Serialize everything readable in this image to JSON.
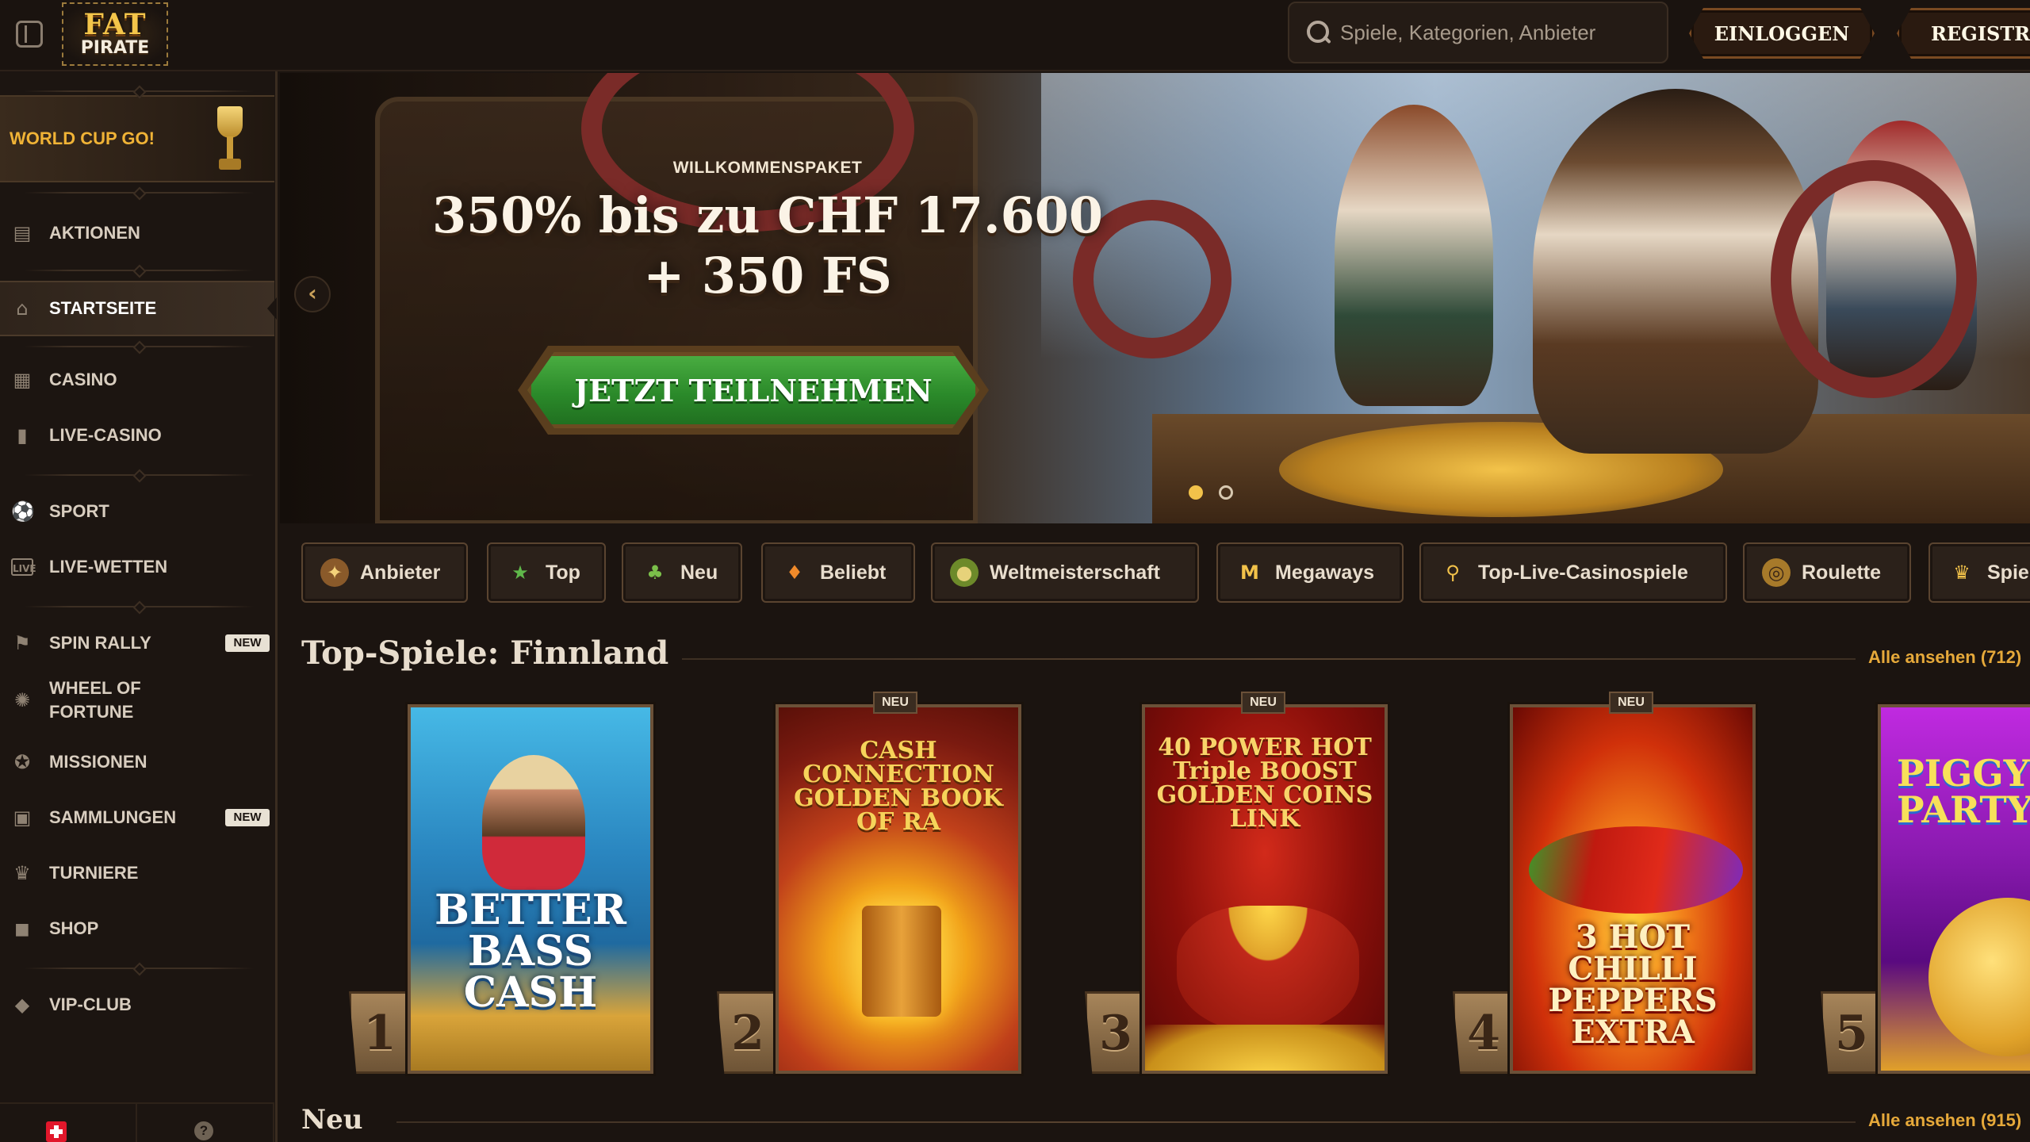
{
  "header": {
    "logo_line1": "FAT",
    "logo_line2": "PIRATE",
    "search_placeholder": "Spiele, Kategorien, Anbieter",
    "login_label": "EINLOGGEN",
    "register_label": "REGISTRIEREN"
  },
  "sidebar": {
    "promo_banner": "WORLD CUP GO!",
    "items": [
      {
        "label": "AKTIONEN",
        "icon": "chest-icon"
      },
      {
        "label": "STARTSEITE",
        "icon": "home-icon",
        "active": true
      },
      {
        "label": "CASINO",
        "icon": "slot-machine-icon"
      },
      {
        "label": "LIVE-CASINO",
        "icon": "cards-icon"
      },
      {
        "label": "SPORT",
        "icon": "ball-icon"
      },
      {
        "label": "LIVE-WETTEN",
        "icon": "live-icon"
      },
      {
        "label": "SPIN RALLY",
        "icon": "flag-race-icon",
        "badge": "NEW"
      },
      {
        "label": "WHEEL OF FORTUNE",
        "icon": "wheel-icon"
      },
      {
        "label": "MISSIONEN",
        "icon": "medal-icon"
      },
      {
        "label": "SAMMLUNGEN",
        "icon": "collection-icon",
        "badge": "NEW"
      },
      {
        "label": "TURNIERE",
        "icon": "trophy-icon"
      },
      {
        "label": "SHOP",
        "icon": "bag-icon"
      },
      {
        "label": "VIP-CLUB",
        "icon": "diamond-icon"
      }
    ],
    "footer": {
      "country": "CH",
      "help_glyph": "?"
    }
  },
  "hero": {
    "eyebrow": "WILLKOMMENSPAKET",
    "title_line1": "350% bis zu CHF 17.600",
    "title_line2": "+ 350 FS",
    "cta": "JETZT TEILNEHMEN",
    "prev_glyph": "‹",
    "slides_total": 2,
    "slide_active": 1
  },
  "chips": [
    {
      "label": "Anbieter",
      "icon": "map-icon"
    },
    {
      "label": "Top",
      "icon": "star-icon"
    },
    {
      "label": "Neu",
      "icon": "sprout-icon"
    },
    {
      "label": "Beliebt",
      "icon": "flame-icon"
    },
    {
      "label": "Weltmeisterschaft",
      "icon": "football-icon"
    },
    {
      "label": "Megaways",
      "icon": "megaways-icon"
    },
    {
      "label": "Top-Live-Casinospiele",
      "icon": "torch-icon"
    },
    {
      "label": "Roulette",
      "icon": "roulette-icon"
    },
    {
      "label": "Spie",
      "icon": "trophy-icon"
    }
  ],
  "sections": {
    "top_games": {
      "title": "Top-Spiele: Finnland",
      "link": "Alle ansehen (712)"
    },
    "new_games": {
      "title": "Neu",
      "link": "Alle ansehen (915)"
    }
  },
  "games": [
    {
      "rank": "1",
      "title": "BETTER BASS CASH",
      "badge": ""
    },
    {
      "rank": "2",
      "title": "CASH CONNECTION GOLDEN BOOK OF RA",
      "badge": "NEU"
    },
    {
      "rank": "3",
      "title": "40 POWER HOT Triple BOOST GOLDEN COINS LINK",
      "badge": "NEU"
    },
    {
      "rank": "4",
      "title": "3 HOT CHILLI PEPPERS EXTRA",
      "badge": "NEU"
    },
    {
      "rank": "5",
      "title": "PIGGY PARTY",
      "badge": ""
    }
  ]
}
